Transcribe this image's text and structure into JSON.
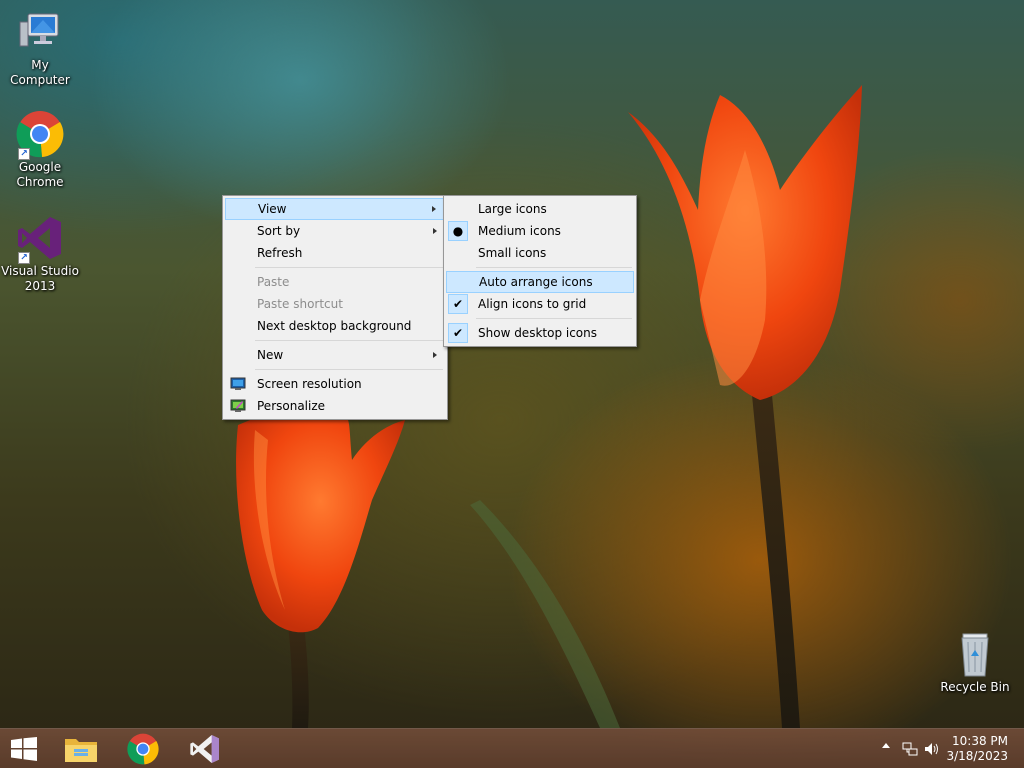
{
  "desktop": {
    "icons": [
      {
        "label": "My Computer"
      },
      {
        "label": "Google\nChrome",
        "line1": "Google",
        "line2": "Chrome"
      },
      {
        "label": "Visual Studio 2013",
        "line1": "Visual Studio",
        "line2": "2013"
      },
      {
        "label": "Recycle Bin"
      }
    ]
  },
  "context_menu": {
    "items": {
      "view": "View",
      "sort_by": "Sort by",
      "refresh": "Refresh",
      "paste": "Paste",
      "paste_shortcut": "Paste shortcut",
      "next_background": "Next desktop background",
      "new": "New",
      "screen_resolution": "Screen resolution",
      "personalize": "Personalize"
    }
  },
  "view_submenu": {
    "items": {
      "large_icons": "Large icons",
      "medium_icons": "Medium icons",
      "small_icons": "Small icons",
      "auto_arrange": "Auto arrange icons",
      "align_to_grid": "Align icons to grid",
      "show_desktop_icons": "Show desktop icons"
    },
    "selected_size": "Medium icons",
    "auto_arrange_checked": false,
    "align_to_grid_checked": true,
    "show_desktop_icons_checked": true
  },
  "taskbar": {
    "pinned": [
      "windows-start",
      "file-explorer",
      "google-chrome",
      "visual-studio"
    ],
    "clock": {
      "time": "10:38 PM",
      "date": "3/18/2023"
    }
  },
  "colors": {
    "menu_highlight": "#cde8ff",
    "menu_highlight_border": "#99d1ff",
    "tulip": "#f04a14"
  }
}
